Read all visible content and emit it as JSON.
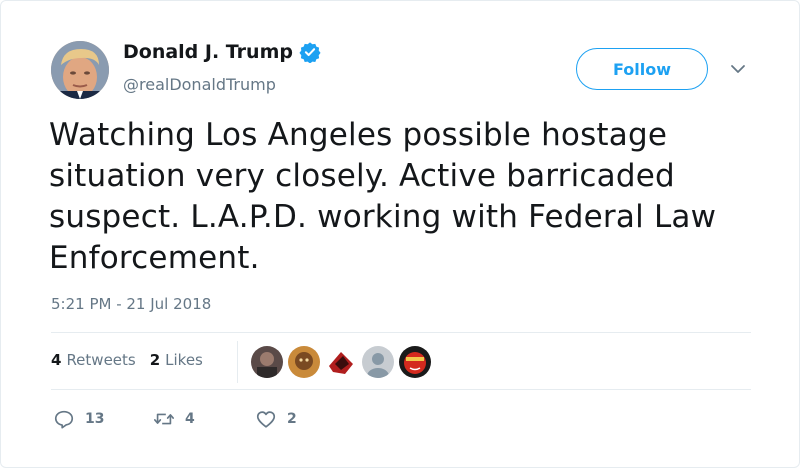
{
  "author": {
    "display_name": "Donald J. Trump",
    "handle": "@realDonaldTrump",
    "verified_icon": "verified-badge-icon",
    "avatar_icon": "profile-avatar"
  },
  "header": {
    "follow_label": "Follow",
    "menu_icon": "chevron-down-icon"
  },
  "tweet": {
    "text": "Watching Los Angeles possible hostage situation very closely. Active barricaded suspect. L.A.P.D. working with Federal Law Enforcement.",
    "timestamp": "5:21 PM - 21 Jul 2018"
  },
  "stats": {
    "retweets_count": "4",
    "retweets_label": "Retweets",
    "likes_count": "2",
    "likes_label": "Likes"
  },
  "likers": [
    {
      "icon": "liker-avatar-1"
    },
    {
      "icon": "liker-avatar-2"
    },
    {
      "icon": "liker-avatar-3"
    },
    {
      "icon": "liker-avatar-default"
    },
    {
      "icon": "liker-avatar-5"
    }
  ],
  "actions": {
    "reply_count": "13",
    "retweet_count": "4",
    "like_count": "2"
  },
  "colors": {
    "accent": "#1da1f2",
    "secondary_text": "#657786",
    "primary_text": "#14171a",
    "divider": "#e6ecf0"
  }
}
